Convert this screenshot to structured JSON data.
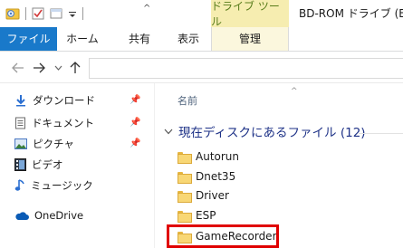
{
  "window": {
    "title": "BD-ROM ドライブ (E:"
  },
  "ribbon": {
    "context_group_label": "ドライブ ツール",
    "tabs": [
      {
        "label": "ファイル"
      },
      {
        "label": "ホーム"
      },
      {
        "label": "共有"
      },
      {
        "label": "表示"
      },
      {
        "label": "管理"
      }
    ]
  },
  "nav": {
    "back_icon": "back-arrow-icon",
    "forward_icon": "forward-arrow-icon",
    "recent_icon": "chevron-down-icon",
    "up_icon": "up-arrow-icon"
  },
  "navpane": {
    "items": [
      {
        "label": "ダウンロード",
        "icon": "download-icon",
        "pinned": true
      },
      {
        "label": "ドキュメント",
        "icon": "document-icon",
        "pinned": true
      },
      {
        "label": "ピクチャ",
        "icon": "picture-icon",
        "pinned": true
      },
      {
        "label": "ビデオ",
        "icon": "video-icon",
        "pinned": false
      },
      {
        "label": "ミュージック",
        "icon": "music-icon",
        "pinned": false
      },
      {
        "label": "OneDrive",
        "icon": "onedrive-cloud-icon",
        "pinned": false
      }
    ]
  },
  "content": {
    "column_header": "名前",
    "group_header": "現在ディスクにあるファイル (12)",
    "files": [
      {
        "name": "Autorun"
      },
      {
        "name": "Dnet35"
      },
      {
        "name": "Driver"
      },
      {
        "name": "ESP"
      },
      {
        "name": "GameRecorder"
      }
    ],
    "highlighted_file": "GameRecorder",
    "highlight_color": "#e00000"
  },
  "colors": {
    "accent": "#1979ca",
    "context_tab": "#f6edb0",
    "group_header": "#1e3287"
  }
}
